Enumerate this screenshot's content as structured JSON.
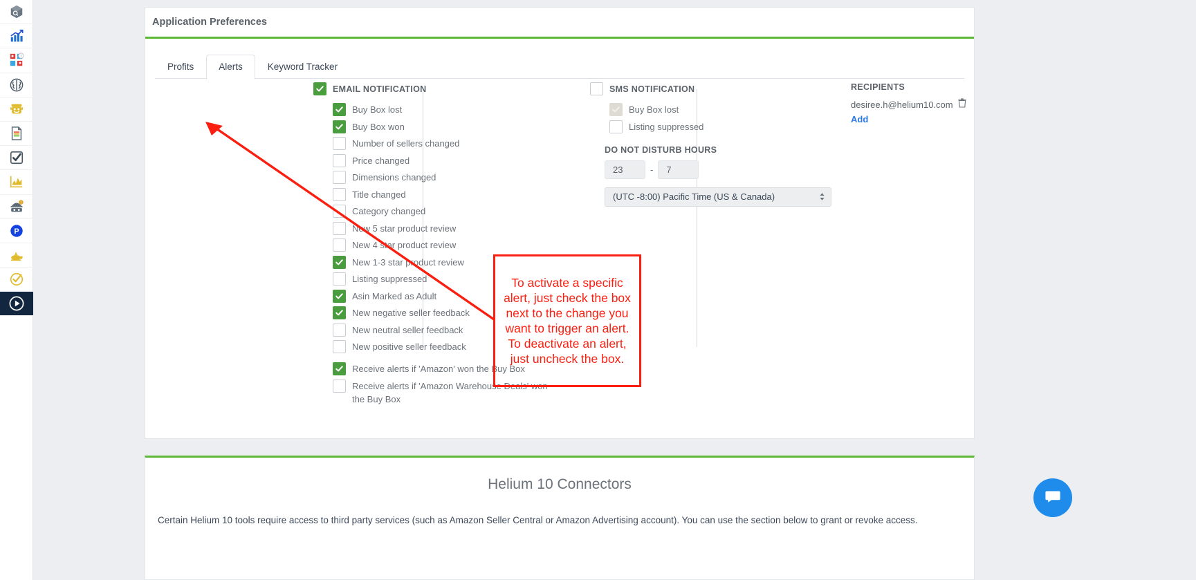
{
  "sidebar": {
    "items": [
      {
        "name": "black-box-icon",
        "label": "Black Box",
        "active": false
      },
      {
        "name": "trendster-chart-icon",
        "label": "Trendster",
        "active": false
      },
      {
        "name": "magnet-keyword-icon",
        "label": "Magnet",
        "active": false
      },
      {
        "name": "cerebro-brain-icon",
        "label": "Cerebro",
        "active": false
      },
      {
        "name": "frankenstein-icon",
        "label": "Frankenstein",
        "active": false
      },
      {
        "name": "scribbles-document-icon",
        "label": "Scribbles",
        "active": false
      },
      {
        "name": "index-checker-icon",
        "label": "Index Checker",
        "active": false
      },
      {
        "name": "keyword-tracker-chart-icon",
        "label": "Keyword Tracker",
        "active": false
      },
      {
        "name": "alerts-spy-icon",
        "label": "Alerts",
        "active": false
      },
      {
        "name": "profits-icon",
        "label": "Profits",
        "active": false
      },
      {
        "name": "magic-lamp-icon",
        "label": "Magic Lamp",
        "active": false
      },
      {
        "name": "refund-genie-icon",
        "label": "Refund Genie",
        "active": false
      },
      {
        "name": "training-play-icon",
        "label": "Training",
        "active": true
      }
    ]
  },
  "preferences": {
    "title": "Application Preferences",
    "tabs": [
      {
        "label": "Profits",
        "active": false
      },
      {
        "label": "Alerts",
        "active": true
      },
      {
        "label": "Keyword Tracker",
        "active": false
      }
    ],
    "email": {
      "section_label": "EMAIL NOTIFICATION",
      "section_checked": true,
      "options": [
        {
          "label": "Buy Box lost",
          "checked": true
        },
        {
          "label": "Buy Box won",
          "checked": true
        },
        {
          "label": "Number of sellers changed",
          "checked": false
        },
        {
          "label": "Price changed",
          "checked": false
        },
        {
          "label": "Dimensions changed",
          "checked": false
        },
        {
          "label": "Title changed",
          "checked": false
        },
        {
          "label": "Category changed",
          "checked": false
        },
        {
          "label": "New 5 star product review",
          "checked": false
        },
        {
          "label": "New 4 star product review",
          "checked": false
        },
        {
          "label": "New 1-3 star product review",
          "checked": true
        },
        {
          "label": "Listing suppressed",
          "checked": false
        },
        {
          "label": "Asin Marked as Adult",
          "checked": true
        },
        {
          "label": "New negative seller feedback",
          "checked": true
        },
        {
          "label": "New neutral seller feedback",
          "checked": false
        },
        {
          "label": "New positive seller feedback",
          "checked": false
        }
      ],
      "extra_options": [
        {
          "label": "Receive alerts if 'Amazon' won the Buy Box",
          "checked": true
        },
        {
          "label": "Receive alerts if 'Amazon Warehouse Deals' won the Buy Box",
          "checked": false
        }
      ]
    },
    "sms": {
      "section_label": "SMS NOTIFICATION",
      "section_checked": false,
      "options": [
        {
          "label": "Buy Box lost",
          "checked": true,
          "disabled": true
        },
        {
          "label": "Listing suppressed",
          "checked": false,
          "disabled": false
        }
      ],
      "dnd_label": "DO NOT DISTURB HOURS",
      "dnd_from": "23",
      "dnd_separator": "-",
      "dnd_to": "7",
      "timezone": "(UTC -8:00) Pacific Time (US & Canada)"
    },
    "recipients": {
      "title": "RECIPIENTS",
      "list": [
        {
          "email": "desiree.h@helium10.com",
          "delete_icon": "trash-icon"
        }
      ],
      "add_label": "Add"
    }
  },
  "annotation": {
    "text": "To activate a specific alert, just check the box next to the change you want to trigger an alert. To deactivate an alert, just uncheck the box.",
    "color": "#fa1f11"
  },
  "connectors": {
    "title": "Helium 10 Connectors",
    "description": "Certain Helium 10 tools require access to third party services (such as Amazon Seller Central or Amazon Advertising account). You can use the section below to grant or revoke access."
  },
  "support": {
    "icon": "intercom-chat-icon",
    "color": "#1f8ceb"
  },
  "theme": {
    "accent_green": "#5cb734",
    "checkbox_green": "#4a9d3f",
    "link_blue": "#2c7be5",
    "sidebar_active": "#12263f"
  }
}
